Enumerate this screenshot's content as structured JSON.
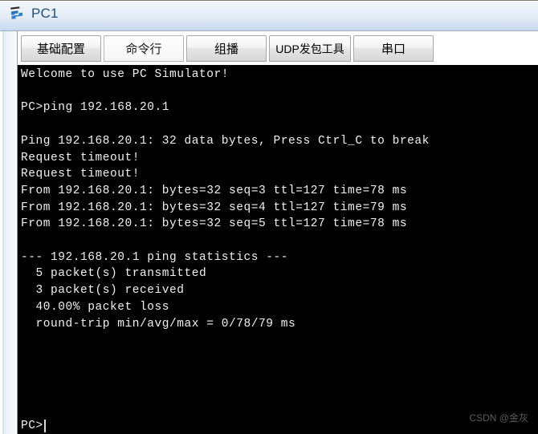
{
  "window": {
    "title": "PC1",
    "icon": "pc-terminal-icon"
  },
  "tabs": [
    {
      "label": "基础配置",
      "selected": false,
      "name": "tab-basic-config"
    },
    {
      "label": "命令行",
      "selected": true,
      "name": "tab-command-line"
    },
    {
      "label": "组播",
      "selected": false,
      "name": "tab-multicast"
    },
    {
      "label": "UDP发包工具",
      "selected": false,
      "name": "tab-udp-tool"
    },
    {
      "label": "串口",
      "selected": false,
      "name": "tab-serial-port"
    }
  ],
  "terminal": {
    "content": "Welcome to use PC Simulator!\n\nPC>ping 192.168.20.1\n\nPing 192.168.20.1: 32 data bytes, Press Ctrl_C to break\nRequest timeout!\nRequest timeout!\nFrom 192.168.20.1: bytes=32 seq=3 ttl=127 time=78 ms\nFrom 192.168.20.1: bytes=32 seq=4 ttl=127 time=79 ms\nFrom 192.168.20.1: bytes=32 seq=5 ttl=127 time=78 ms\n\n--- 192.168.20.1 ping statistics ---\n  5 packet(s) transmitted\n  3 packet(s) received\n  40.00% packet loss\n  round-trip min/avg/max = 0/78/79 ms",
    "prompt": "PC>",
    "background_color": "#000000",
    "text_color": "#f0f0f0"
  },
  "watermark": {
    "text": "CSDN @金灰"
  }
}
